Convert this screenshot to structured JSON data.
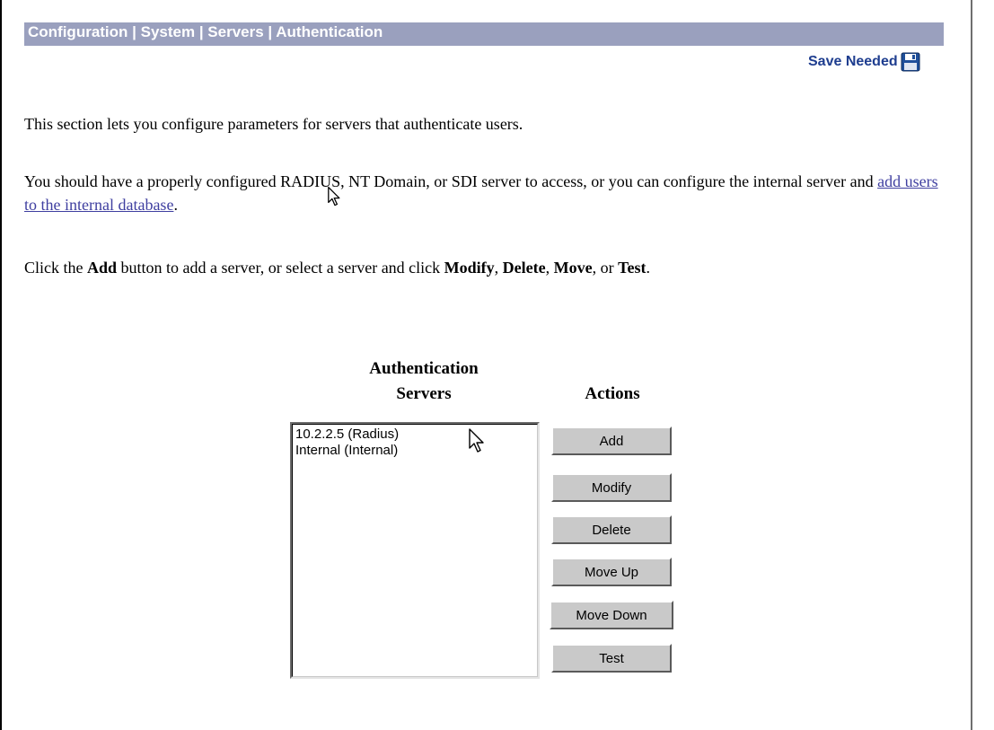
{
  "breadcrumb": {
    "text": "Configuration | System | Servers | Authentication"
  },
  "save_needed": {
    "label": "Save Needed",
    "icon": "floppy-disk-icon"
  },
  "intro": {
    "line1": "This section lets you configure parameters for servers that authenticate users.",
    "line2_prefix": "You should have a properly configured RADIUS, NT Domain, or SDI server to access, or you can configure the internal server and ",
    "line2_link": "add users to the internal database",
    "line2_suffix": ".",
    "line3_a": "Click the ",
    "line3_add": "Add",
    "line3_b": " button to add a server, or select a server and click ",
    "line3_modify": "Modify",
    "line3_c": ", ",
    "line3_delete": "Delete",
    "line3_d": ", ",
    "line3_move": "Move",
    "line3_e": ", or ",
    "line3_test": "Test",
    "line3_f": "."
  },
  "servers": {
    "header_line1": "Authentication",
    "header_line2": "Servers",
    "options": [
      "10.2.2.5 (Radius)",
      "Internal (Internal)"
    ]
  },
  "actions": {
    "header": "Actions",
    "buttons": {
      "add": "Add",
      "modify": "Modify",
      "delete": "Delete",
      "move_up": "Move Up",
      "move_down": "Move Down",
      "test": "Test"
    }
  },
  "colors": {
    "breadcrumb_bar": "#9aa0be",
    "save_text": "#1e3d8f",
    "link": "#3f3fa0",
    "button_face": "#c9c9c9"
  }
}
